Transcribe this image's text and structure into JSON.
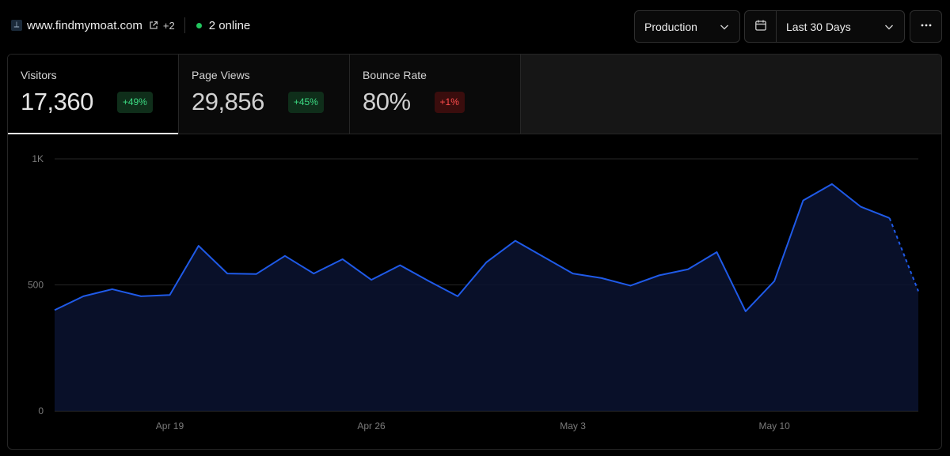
{
  "header": {
    "site_name": "www.findmymoat.com",
    "site_extra": "+2",
    "online_text": "2 online",
    "environment": "Production",
    "date_range": "Last 30 Days"
  },
  "icons": {
    "favicon": "site-favicon",
    "external": "external-link-icon",
    "calendar": "calendar-icon",
    "chevron": "chevron-down-icon",
    "more": "more-horizontal-icon"
  },
  "colors": {
    "accent_line": "#1f5ae8",
    "online": "#22c55e",
    "positive": "#3ddc84",
    "negative": "#ff4d4d"
  },
  "metrics": [
    {
      "label": "Visitors",
      "value": "17,360",
      "change": "+49%",
      "trend": "up"
    },
    {
      "label": "Page Views",
      "value": "29,856",
      "change": "+45%",
      "trend": "up"
    },
    {
      "label": "Bounce Rate",
      "value": "80%",
      "change": "+1%",
      "trend": "down"
    }
  ],
  "chart_data": {
    "type": "area",
    "title": "",
    "xlabel": "",
    "ylabel": "",
    "ylim": [
      0,
      1000
    ],
    "yticks": [
      {
        "value": 0,
        "label": "0"
      },
      {
        "value": 500,
        "label": "500"
      },
      {
        "value": 1000,
        "label": "1K"
      }
    ],
    "x_tick_labels": [
      {
        "index": 4,
        "label": "Apr 19"
      },
      {
        "index": 11,
        "label": "Apr 26"
      },
      {
        "index": 18,
        "label": "May 3"
      },
      {
        "index": 25,
        "label": "May 10"
      }
    ],
    "grid": true,
    "dashed_last_segment": true,
    "series": [
      {
        "values": [
          400,
          455,
          483,
          455,
          460,
          655,
          545,
          543,
          615,
          545,
          602,
          520,
          578,
          515,
          455,
          590,
          675,
          610,
          545,
          527,
          497,
          538,
          562,
          630,
          395,
          515,
          835,
          900,
          810,
          765,
          475
        ]
      }
    ]
  }
}
